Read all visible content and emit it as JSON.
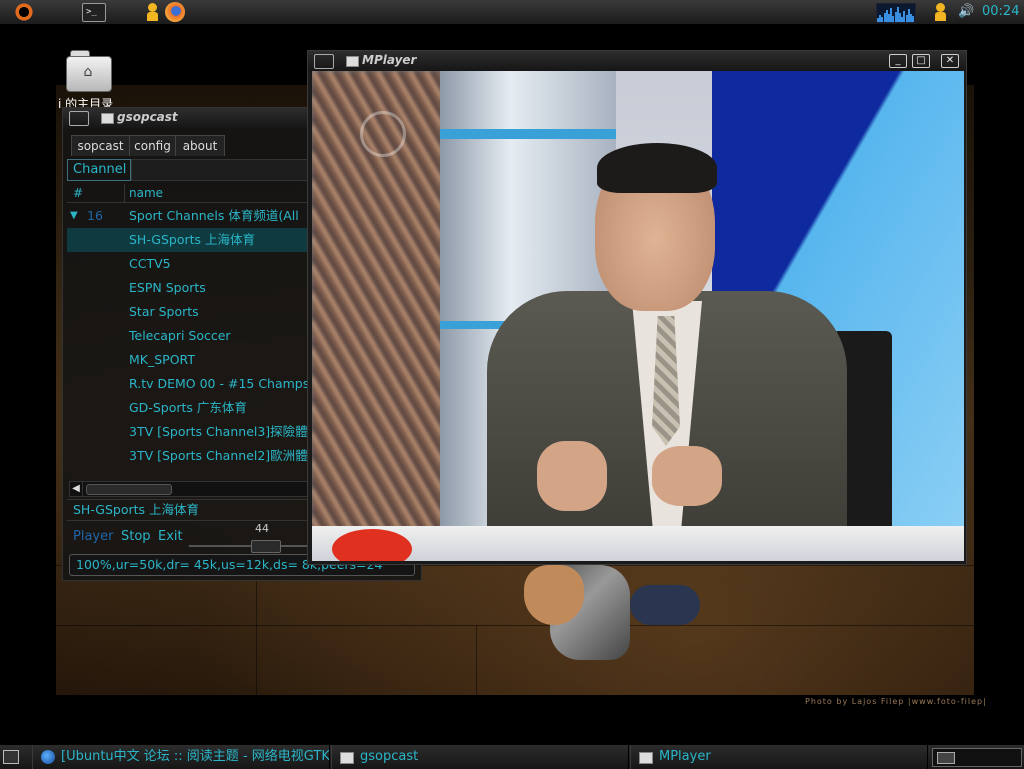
{
  "top_panel": {
    "terminal_glyph": ">_",
    "clock": "00:24",
    "volume_glyph": "🔊"
  },
  "desktop": {
    "home_label": "i 的主目录",
    "photo_credit": "Photo by Lajos Filep |www.foto-filep|"
  },
  "gsopcast": {
    "title": "gsopcast",
    "tabs": [
      "sopcast",
      "config",
      "about"
    ],
    "channel_tab": "Channel",
    "columns": [
      "#",
      "name"
    ],
    "group": {
      "num": "16",
      "name": "Sport Channels  体育频道(All"
    },
    "channels": [
      "SH-GSports 上海体育",
      "CCTV5",
      "ESPN Sports",
      "Star Sports",
      "Telecapri Soccer",
      "MK_SPORT",
      "R.tv DEMO 00 - #15 Champs",
      "GD-Sports 广东体育",
      "3TV [Sports Channel3]探險體",
      "3TV [Sports Channel2]歐洲體"
    ],
    "status_channel": "SH-GSports 上海体育",
    "controls": {
      "player": "Player",
      "stop": "Stop",
      "exit": "Exit"
    },
    "volume": "44",
    "stats": "100%,ur=50k,dr= 45k,us=12k,ds=  8k,peers=24"
  },
  "mplayer": {
    "title": "MPlayer",
    "btn_min": "_",
    "btn_max": "□",
    "btn_close": "✕"
  },
  "taskbar": {
    "tasks": [
      "[Ubuntu中文 论坛 :: 阅读主题 - 网络电视GTK",
      "gsopcast",
      "MPlayer"
    ]
  },
  "colors": {
    "accent": "#2ab6c8",
    "link_blue": "#1f66a8"
  }
}
